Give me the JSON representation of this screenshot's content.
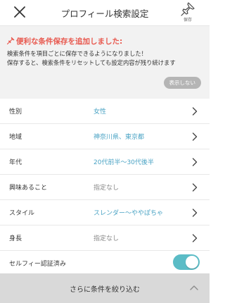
{
  "header": {
    "title": "プロフィール検索設定",
    "save_label": "保存",
    "close_icon": "close-icon",
    "save_icon": "pin-icon"
  },
  "notice": {
    "title": "便利な条件保存を追加しました:",
    "line1": "検索条件を項目ごとに保存できるようになりました！",
    "line2": "保存すると、検索条件をリセットしても設定内容が残り続けます",
    "hide_label": "表示しない",
    "title_color": "#e8584e"
  },
  "filters": [
    {
      "label": "性別",
      "value": "女性",
      "value_style": "blue"
    },
    {
      "label": "地域",
      "value": "神奈川県、東京都",
      "value_style": "blue"
    },
    {
      "label": "年代",
      "value": "20代前半〜30代後半",
      "value_style": "blue"
    },
    {
      "label": "興味あること",
      "value": "指定なし",
      "value_style": "gray"
    },
    {
      "label": "スタイル",
      "value": "スレンダー〜ややぽちゃ",
      "value_style": "blue"
    },
    {
      "label": "身長",
      "value": "指定なし",
      "value_style": "gray"
    }
  ],
  "selfie": {
    "label": "セルフィー認証済み",
    "enabled": true
  },
  "footer": {
    "label": "さらに条件を絞り込む"
  },
  "colors": {
    "accent_blue": "#4aa3c4",
    "toggle_on": "#5bbcc6",
    "notice_red": "#e8584e"
  }
}
